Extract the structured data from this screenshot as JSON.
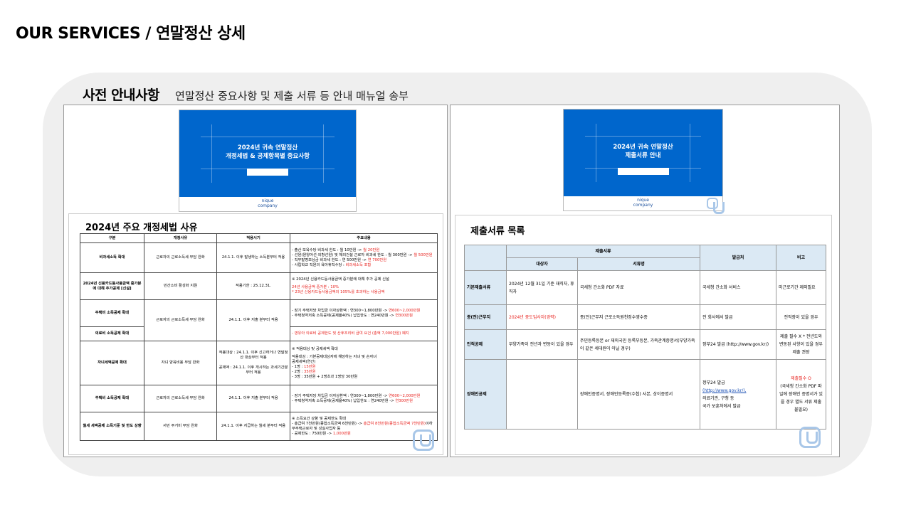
{
  "page_title": "OUR SERVICES / 연말정산 상세",
  "section": {
    "title": "사전 안내사항",
    "subtitle": "연말정산 중요사항 및 제출 서류 등 안내 매뉴얼 송부"
  },
  "cover_left": {
    "line1": "2024년 귀속 연말정산",
    "line2": "개정세법 & 공제항목별 중요사항",
    "logo_line1": "nique",
    "logo_line2": "company"
  },
  "cover_right": {
    "line1": "2024년 귀속 연말정산",
    "line2": "제출서류 안내",
    "logo_line1": "nique",
    "logo_line2": "company"
  },
  "table1": {
    "title": "2024년 주요 개정세법 사유",
    "headers": [
      "구분",
      "개정사유",
      "적용시기",
      "주요내용"
    ],
    "rows": [
      {
        "category": "비과세소득 확대",
        "reason": "근로자의 근로소득세 부담 완화",
        "timing": "24.1.1. 이후 발생하는 소득분부터 적용",
        "content": [
          {
            "text": "- 출산 보육수당 비과세 한도 : 월 10만원 -> ",
            "red": "월 20만원"
          },
          {
            "text": "- 선원(원양어선·외항선원) 및 해외건설 근로자 비과세 한도 : 월 300만원 -> ",
            "red": "월 500만원"
          },
          {
            "text": "- 직무발명보상금 비과세 한도 : 연 500만원 -> ",
            "red": "연 700만원"
          },
          {
            "text": "- 사립학교 직원의 육아휴직수당 : ",
            "red": "비과세소득 포함"
          }
        ]
      },
      {
        "category": "2024년 신용카드등사용금액 증가분에 대해 추가공제 [신설]",
        "reason": "민간소비 활성화 지원",
        "timing": "적용기한 : 25.12.31.",
        "content": [
          {
            "text": "※ 2024년 신용카드등사용금액 증가분에 대해 추가 공제 신설",
            "red": ""
          },
          {
            "text": "",
            "red": "24년 사용금액 증가분 : 10%"
          },
          {
            "text": "",
            "red": "* 23년 신용카드등사용금액의 105%를 초과하는 사용금액"
          }
        ]
      },
      {
        "category": "주택비 소득공제 확대",
        "reason": "근로자의 근로소득세 부담 완화",
        "timing": "24.1.1. 이후 지출 분부터 적용",
        "content": [
          {
            "text": "- 장기 주택저당 차입금 이자상환액 : 연300~1,800만원 -> ",
            "red": "연600~2,000만원"
          },
          {
            "text": "- 주택청약저축 소득공제(공제율40%) 납입한도 : 연240만원 -> ",
            "red": "연300만원"
          }
        ]
      },
      {
        "category": "의료비 소득공제 확대",
        "content": [
          {
            "text": "",
            "red": "- 영유아 의료비 공제한도 및 산후조리비 급여 요건 (총액 7,000만원) 폐지"
          }
        ]
      },
      {
        "category": "자녀세액공제 확대",
        "reason": "자녀 양육비용 부담 완화",
        "timing": "적용대상 : 24.1.1. 이후 신고하거나 연말정산 대상부터 적용\n\n공제액 : 24.1.1. 이후 개시하는 과세기간분부터 적용",
        "content": [
          {
            "text": "※ 적용대상 및 공제세액 확대",
            "red": ""
          },
          {
            "text": "적용대상 : 기본공제대상자에 해당하는 자녀 및 손자녀",
            "red": ""
          },
          {
            "text": "공제세액(연간)",
            "red": ""
          },
          {
            "text": "- 1명 : ",
            "red": "15만원"
          },
          {
            "text": "- 2명 : ",
            "red": "35만원"
          },
          {
            "text": "- 3명 : 35만원 + 2명초과 1명당 30만원",
            "red": ""
          }
        ]
      },
      {
        "category": "주택비 소득공제 확대",
        "reason": "근로자의 근로소득세 부담 완화",
        "timing": "24.1.1. 이후 지출 분부터 적용",
        "content": [
          {
            "text": "- 장기 주택저당 차입금 이자상환액 : 연300~1,800만원 -> ",
            "red": "연600~2,000만원"
          },
          {
            "text": "- 주택청약저축 소득공제(공제율40%) 납입한도 : 연240만원 -> ",
            "red": "연300만원"
          }
        ]
      },
      {
        "category": "월세 세액공제 소득기준 및 한도 상향",
        "reason": "서민 주거비 부담 완화",
        "timing": "24.1.1. 이후 지급하는 월세 분부터 적용",
        "content": [
          {
            "text": "※ 소득요건 상향 및 공제한도 확대",
            "red": ""
          },
          {
            "text": "- 총급여 7천만원(종합소득금액 6천만원) -> ",
            "red": "총급여 8천만원(종합소득금액 7천만원)"
          },
          {
            "text": "이하 무주택근로자 및 성실사업자 등",
            "red": ""
          },
          {
            "text": "- 공제한도 : 750만원 -> ",
            "red": "1,000만원"
          }
        ]
      }
    ]
  },
  "table2": {
    "title": "제출서류 목록",
    "headers": {
      "group": "제출서류",
      "target": "대상자",
      "doc_name": "서류명",
      "issuer": "발급처",
      "note": "비고"
    },
    "rows": [
      {
        "category": "기본제출서류",
        "target": "2024년 12월 31일 기준 재직자, 휴직자",
        "target_red": "",
        "doc": "국세청 간소화 PDF 자료",
        "issuer": "국세청 간소화 서비스",
        "note": "미근로기간 제외필요",
        "note_red": ""
      },
      {
        "category": "종(전)근무지",
        "target": "",
        "target_red": "2024년 중도입사자(경력)",
        "doc": "종(전)근무지 근로소득원천징수영수증",
        "issuer": "전 회사에서 발급",
        "note": "전직장이 있을 경우",
        "note_red": ""
      },
      {
        "category": "인적공제",
        "target": "부양가족이 전년과 변동이 있을 경우",
        "target_red": "",
        "doc": "주민등록등본 or 재외국민 등록부등본, 가족관계증명서(부양가족이 같은 세대원이 아닐 경우)",
        "issuer": "정부24 발급 (http://www.gov.kr/)",
        "note": "제출 필수 X * 전년도와 변동된 사항이 있을 경우 제출 권장",
        "note_red": ""
      },
      {
        "category": "장애인공제",
        "target": "",
        "target_red": "",
        "doc": "장애인증명서, 장애인등록증(수첩) 사본, 상이증명서",
        "issuer_line1": "정부24 발급",
        "issuer_link": "(http://www.gov.kr/),",
        "issuer_line2": "의료기관, 구청 등",
        "issuer_line3": "국가 보훈처에서 발급",
        "note": "(국세청 간소화 PDF 파일에 장애인 증명서가 있을 경우 별도 서류 제출 불필요)",
        "note_red": "제출필수 O"
      }
    ]
  },
  "colors": {
    "cover_blue": "#0066cc",
    "accent_red": "#e8211d",
    "header_bg": "#dbe9f4",
    "panel_bg": "#efefef"
  }
}
